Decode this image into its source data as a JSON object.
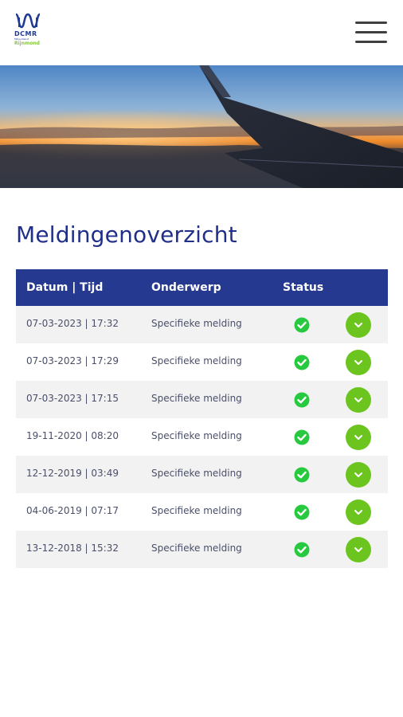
{
  "header": {
    "logo": {
      "brand": "DCMR",
      "sub1": "Milieudienst",
      "sub2": "Rijnmond"
    }
  },
  "main": {
    "title": "Meldingenoverzicht"
  },
  "table": {
    "columns": {
      "date": "Datum | Tijd",
      "subject": "Onderwerp",
      "status": "Status"
    },
    "rows": [
      {
        "date": "07-03-2023 | 17:32",
        "subject": "Specifieke melding"
      },
      {
        "date": "07-03-2023 | 17:29",
        "subject": "Specifieke melding"
      },
      {
        "date": "07-03-2023 | 17:15",
        "subject": "Specifieke melding"
      },
      {
        "date": "19-11-2020 | 08:20",
        "subject": "Specifieke melding"
      },
      {
        "date": "12-12-2019 | 03:49",
        "subject": "Specifieke melding"
      },
      {
        "date": "04-06-2019 | 07:17",
        "subject": "Specifieke melding"
      },
      {
        "date": "13-12-2018 | 15:32",
        "subject": "Specifieke melding"
      }
    ]
  },
  "colors": {
    "accent": "#24398f",
    "status_ok": "#27c93f",
    "expand": "#6cc51f"
  }
}
